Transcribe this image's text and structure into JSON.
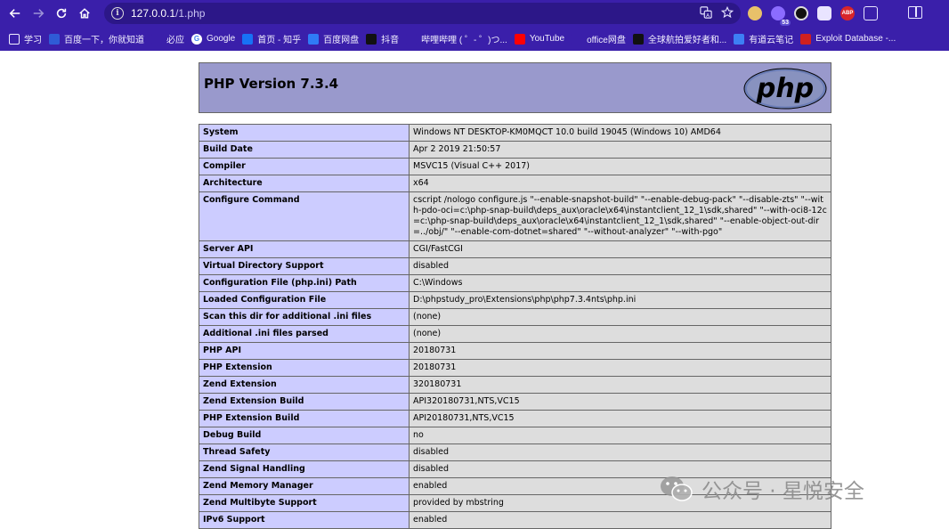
{
  "browser": {
    "url_host": "127.0.0.1",
    "url_path": "/1.php",
    "translate_icon": "translate-icon",
    "star_icon": "star-icon",
    "ext_badge": "53",
    "abp_label": "ABP"
  },
  "bookmarks": [
    {
      "label": "学习",
      "icon": "folder-icon",
      "color": "#3a1faa"
    },
    {
      "label": "百度一下，你就知道",
      "icon": "baidu-icon",
      "color": "#2f5bd6"
    },
    {
      "label": "必应",
      "icon": "search-icon",
      "color": "#3a1faa"
    },
    {
      "label": "Google",
      "icon": "google-icon",
      "color": "#ffffff"
    },
    {
      "label": "首页 - 知乎",
      "icon": "zhihu-icon",
      "color": "#1772f6"
    },
    {
      "label": "百度网盘",
      "icon": "baidupan-icon",
      "color": "#2f7bf6"
    },
    {
      "label": "抖音",
      "icon": "douyin-icon",
      "color": "#111111"
    },
    {
      "label": "哔哩哔哩 ( ゜- ゜)つ...",
      "icon": "bilibili-icon",
      "color": "#3a1faa"
    },
    {
      "label": "YouTube",
      "icon": "youtube-icon",
      "color": "#ff0000"
    },
    {
      "label": "office网盘",
      "icon": "office-icon",
      "color": "#3a1faa"
    },
    {
      "label": "全球航拍爱好者和...",
      "icon": "skypixel-icon",
      "color": "#111111"
    },
    {
      "label": "有道云笔记",
      "icon": "youdao-icon",
      "color": "#3d7ff5"
    },
    {
      "label": "Exploit Database -...",
      "icon": "exploitdb-icon",
      "color": "#d02020"
    }
  ],
  "page": {
    "title": "PHP Version 7.3.4",
    "logo_text": "php",
    "rows": [
      {
        "key": "System",
        "value": "Windows NT DESKTOP-KM0MQCT 10.0 build 19045 (Windows 10) AMD64"
      },
      {
        "key": "Build Date",
        "value": "Apr 2 2019 21:50:57"
      },
      {
        "key": "Compiler",
        "value": "MSVC15 (Visual C++ 2017)"
      },
      {
        "key": "Architecture",
        "value": "x64"
      },
      {
        "key": "Configure Command",
        "value": "cscript /nologo configure.js \"--enable-snapshot-build\" \"--enable-debug-pack\" \"--disable-zts\" \"--with-pdo-oci=c:\\php-snap-build\\deps_aux\\oracle\\x64\\instantclient_12_1\\sdk,shared\" \"--with-oci8-12c=c:\\php-snap-build\\deps_aux\\oracle\\x64\\instantclient_12_1\\sdk,shared\" \"--enable-object-out-dir=../obj/\" \"--enable-com-dotnet=shared\" \"--without-analyzer\" \"--with-pgo\""
      },
      {
        "key": "Server API",
        "value": "CGI/FastCGI"
      },
      {
        "key": "Virtual Directory Support",
        "value": "disabled"
      },
      {
        "key": "Configuration File (php.ini) Path",
        "value": "C:\\Windows"
      },
      {
        "key": "Loaded Configuration File",
        "value": "D:\\phpstudy_pro\\Extensions\\php\\php7.3.4nts\\php.ini"
      },
      {
        "key": "Scan this dir for additional .ini files",
        "value": "(none)"
      },
      {
        "key": "Additional .ini files parsed",
        "value": "(none)"
      },
      {
        "key": "PHP API",
        "value": "20180731"
      },
      {
        "key": "PHP Extension",
        "value": "20180731"
      },
      {
        "key": "Zend Extension",
        "value": "320180731"
      },
      {
        "key": "Zend Extension Build",
        "value": "API320180731,NTS,VC15"
      },
      {
        "key": "PHP Extension Build",
        "value": "API20180731,NTS,VC15"
      },
      {
        "key": "Debug Build",
        "value": "no"
      },
      {
        "key": "Thread Safety",
        "value": "disabled"
      },
      {
        "key": "Zend Signal Handling",
        "value": "disabled"
      },
      {
        "key": "Zend Memory Manager",
        "value": "enabled"
      },
      {
        "key": "Zend Multibyte Support",
        "value": "provided by mbstring"
      },
      {
        "key": "IPv6 Support",
        "value": "enabled"
      }
    ]
  },
  "watermark": {
    "text": "公众号 · 星悦安全"
  },
  "colors": {
    "chrome": "#3a1faa",
    "header_bg": "#9999cc",
    "key_bg": "#ccccff",
    "value_bg": "#dddddd"
  }
}
